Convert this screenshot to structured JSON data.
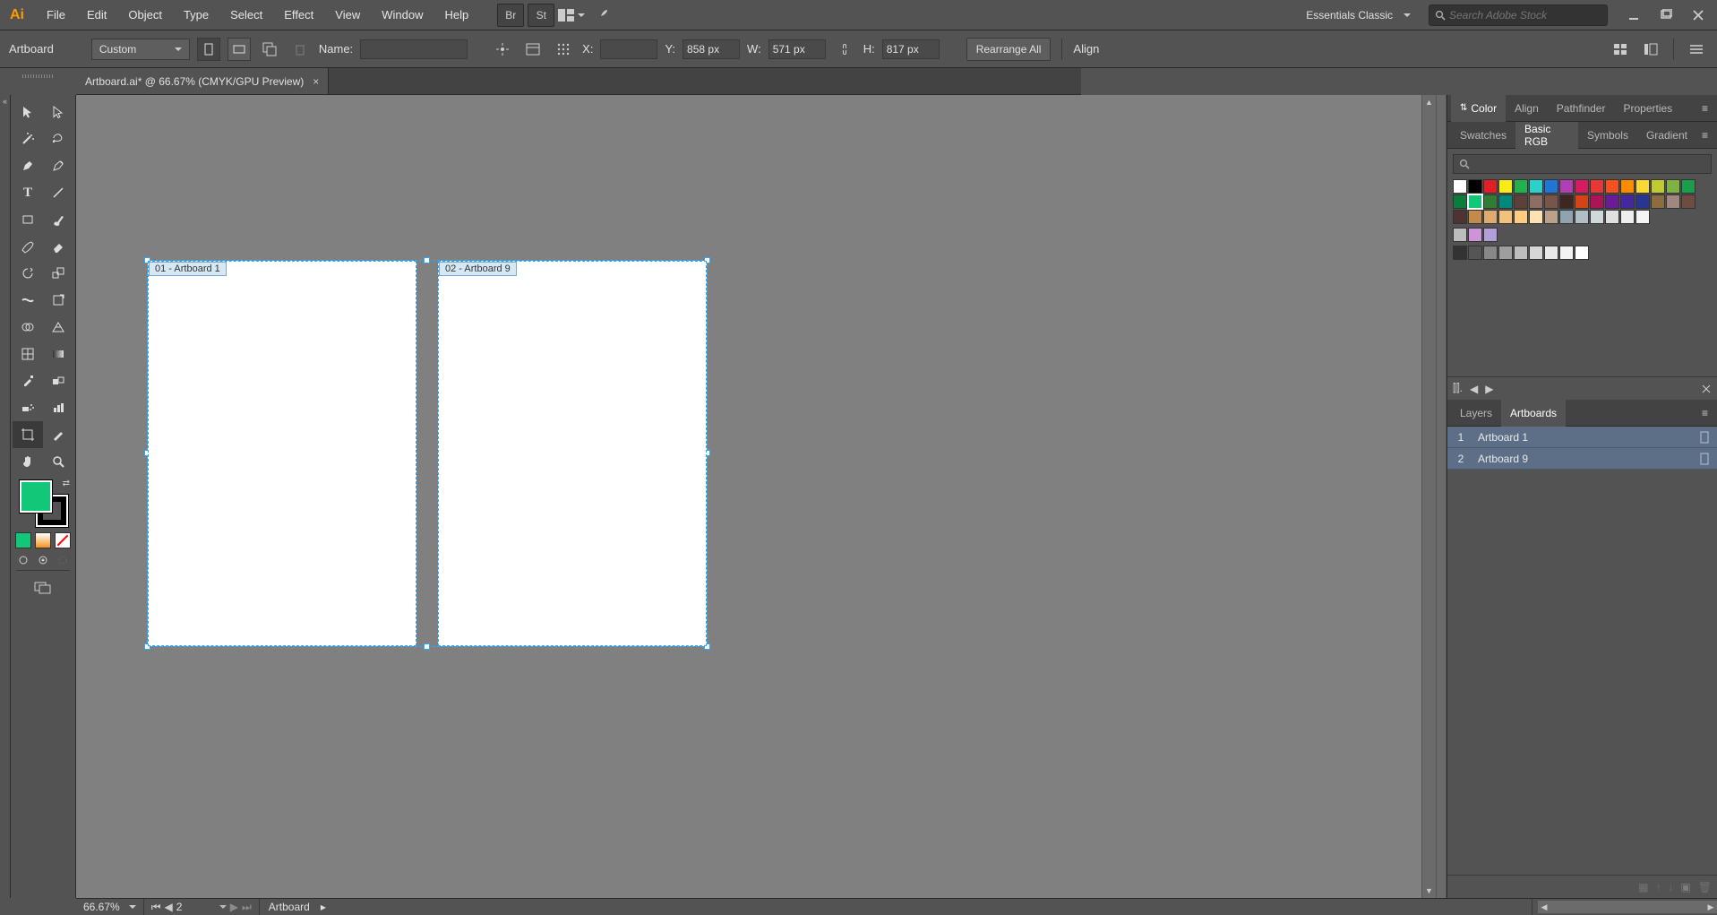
{
  "menu": {
    "items": [
      "File",
      "Edit",
      "Object",
      "Type",
      "Select",
      "Effect",
      "View",
      "Window",
      "Help"
    ],
    "workspace": "Essentials Classic",
    "search_placeholder": "Search Adobe Stock"
  },
  "control": {
    "context": "Artboard",
    "preset": "Custom",
    "name_lbl": "Name:",
    "name_val": "",
    "x_lbl": "X:",
    "x_val": "",
    "y_lbl": "Y:",
    "y_val": "858 px",
    "w_lbl": "W:",
    "w_val": "571 px",
    "h_lbl": "H:",
    "h_val": "817 px",
    "rearrange": "Rearrange All",
    "align": "Align"
  },
  "doc": {
    "tab_title": "Artboard.ai* @ 66.67% (CMYK/GPU Preview)"
  },
  "canvas": {
    "ab1_label": "01 - Artboard 1",
    "ab2_label": "02 - Artboard 9"
  },
  "panels": {
    "group1": {
      "tabs": [
        "Color",
        "Align",
        "Pathfinder",
        "Properties"
      ],
      "active": 0
    },
    "group2": {
      "tabs": [
        "Swatches",
        "Basic RGB",
        "Symbols",
        "Gradient"
      ],
      "active": 1
    },
    "group3": {
      "tabs": [
        "Layers",
        "Artboards"
      ],
      "active": 1
    }
  },
  "swatches": {
    "row1": [
      "#ffffff",
      "#000000",
      "#e11e26",
      "#f7ec13",
      "#22b14c",
      "#2ad1c9",
      "#1f75d8",
      "#b03fb5",
      "#d81b60",
      "#e53935",
      "#f4511e",
      "#fb8c00",
      "#fdd835",
      "#c0ca33",
      "#7cb342"
    ],
    "row2": [
      "#1b9e4b",
      "#0a7d3a",
      "#13c779",
      "#2e7d32",
      "#00897b",
      "#5d4037",
      "#8d6e63",
      "#795548",
      "#3e2723",
      "#d84315",
      "#ad1457",
      "#6a1b9a",
      "#4527a0",
      "#283593",
      "#8b6d3f"
    ],
    "row3": [
      "#a1887f",
      "#6d4c41",
      "#4e342e",
      "#c28a4d",
      "#e0a96d",
      "#f0c27b",
      "#ffcc80",
      "#ffe0b2",
      "#bca18a",
      "#90a4ae",
      "#b0bec5",
      "#cfd8dc",
      "#e0e0e0",
      "#eeeeee",
      "#f5f5f5"
    ],
    "row4": [
      "#bdbdbd",
      "#ce93d8",
      "#b39ddb"
    ],
    "row5": [
      "#333333",
      "#555555",
      "#888888",
      "#9e9e9e",
      "#bdbdbd",
      "#d6d6d6",
      "#e8e8e8",
      "#f2f2f2",
      "#ffffff"
    ]
  },
  "artboards": {
    "rows": [
      {
        "num": "1",
        "name": "Artboard 1"
      },
      {
        "num": "2",
        "name": "Artboard 9"
      }
    ]
  },
  "status": {
    "zoom": "66.67%",
    "nav_value": "2",
    "context": "Artboard"
  },
  "colors": {
    "fill": "#13c779",
    "stroke": "#000000"
  }
}
